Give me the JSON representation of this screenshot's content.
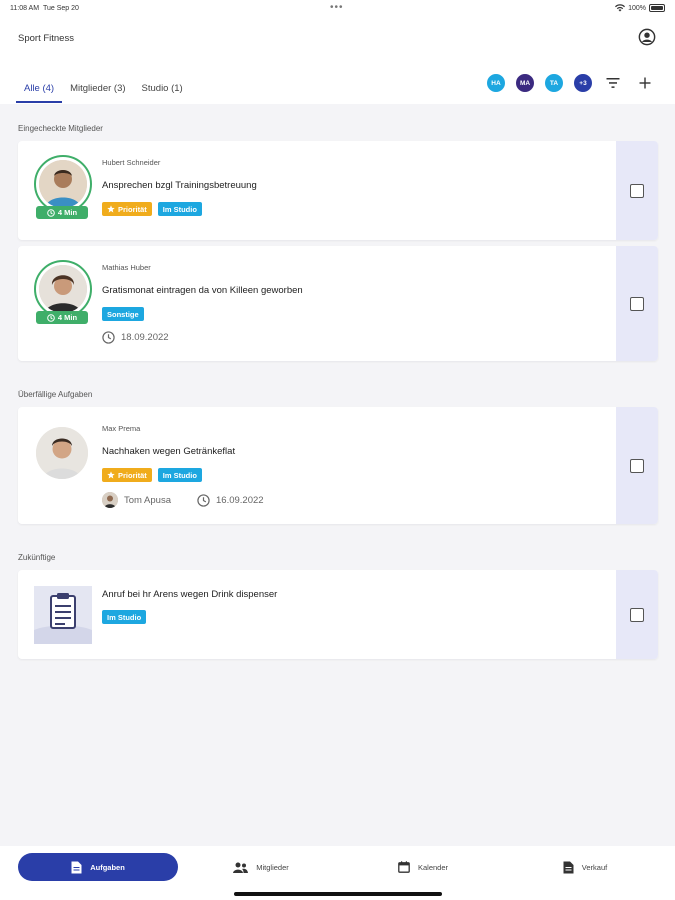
{
  "status_bar": {
    "time": "11:08 AM",
    "date": "Tue Sep 20",
    "battery": "100%"
  },
  "app": {
    "title": "Sport Fitness"
  },
  "tabs": [
    {
      "label": "Alle (4)",
      "active": true
    },
    {
      "label": "Mitglieder (3)",
      "active": false
    },
    {
      "label": "Studio (1)",
      "active": false
    }
  ],
  "assignees": [
    {
      "initials": "HA",
      "color": "#1da7e0"
    },
    {
      "initials": "MA",
      "color": "#3b2a80"
    },
    {
      "initials": "TA",
      "color": "#1da7e0"
    },
    {
      "initials": "+3",
      "color": "#2a3ea8"
    }
  ],
  "sections": {
    "checked_in": "Eingecheckte Mitglieder",
    "overdue": "Überfällige Aufgaben",
    "upcoming": "Zukünftige"
  },
  "tasks": [
    {
      "member": "Hubert Schneider",
      "title": "Ansprechen bzgl Trainingsbetreuung",
      "timer": "4 Min",
      "tags": [
        {
          "label": "Priorität",
          "type": "prio"
        },
        {
          "label": "Im Studio",
          "type": "studio"
        }
      ]
    },
    {
      "member": "Mathias Huber",
      "title": "Gratismonat eintragen da von Killeen geworben",
      "timer": "4 Min",
      "tags": [
        {
          "label": "Sonstige",
          "type": "studio"
        }
      ],
      "date": "18.09.2022"
    },
    {
      "member": "Max Prema",
      "title": "Nachhaken wegen Getränkeflat",
      "tags": [
        {
          "label": "Priorität",
          "type": "prio"
        },
        {
          "label": "Im Studio",
          "type": "studio"
        }
      ],
      "assignee": "Tom Apusa",
      "date": "16.09.2022"
    },
    {
      "title": "Anruf bei hr Arens wegen Drink dispenser",
      "tags": [
        {
          "label": "Im Studio",
          "type": "studio"
        }
      ]
    }
  ],
  "nav": [
    {
      "label": "Aufgaben",
      "icon": "document-icon",
      "active": true
    },
    {
      "label": "Mitglieder",
      "icon": "people-icon",
      "active": false
    },
    {
      "label": "Kalender",
      "icon": "calendar-icon",
      "active": false
    },
    {
      "label": "Verkauf",
      "icon": "receipt-icon",
      "active": false
    }
  ],
  "colors": {
    "primary": "#2a3ea8",
    "success": "#3fae69",
    "priority": "#f0ac1c",
    "studio": "#1da7e0",
    "side_panel": "#e7e8f8"
  }
}
